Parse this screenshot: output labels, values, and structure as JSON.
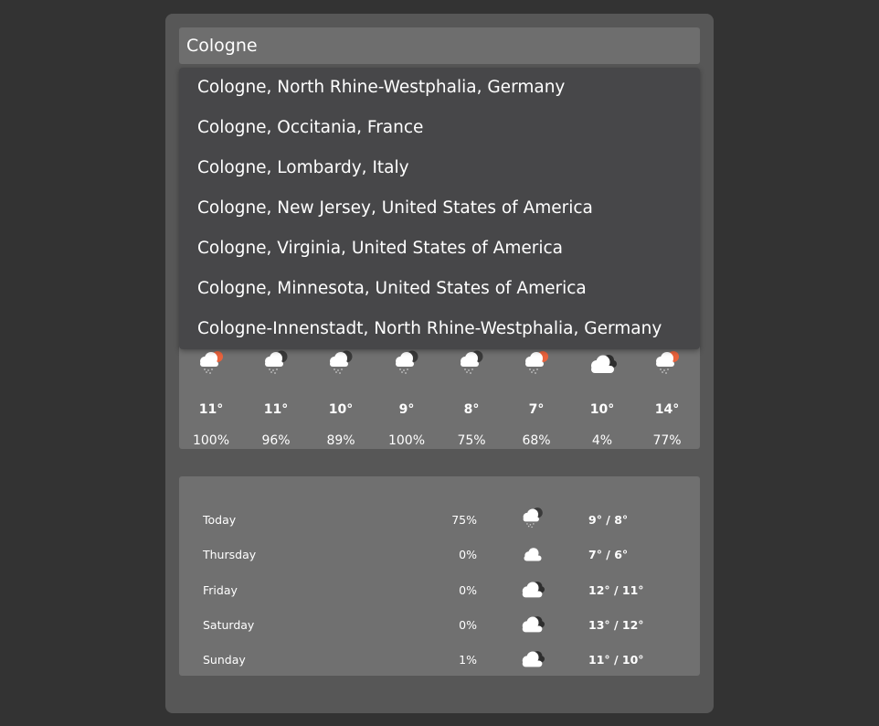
{
  "search": {
    "value": "Cologne"
  },
  "suggestions": [
    "Cologne, North Rhine-Westphalia, Germany",
    "Cologne, Occitania, France",
    "Cologne, Lombardy, Italy",
    "Cologne, New Jersey, United States of America",
    "Cologne, Virginia, United States of America",
    "Cologne, Minnesota, United States of America",
    "Cologne-Innenstadt, North Rhine-Westphalia, Germany"
  ],
  "hourly": [
    {
      "icon": "rain-sun-icon",
      "temp": "11°",
      "precip": "100%"
    },
    {
      "icon": "rain-moon-icon",
      "temp": "11°",
      "precip": "96%"
    },
    {
      "icon": "rain-moon-icon",
      "temp": "10°",
      "precip": "89%"
    },
    {
      "icon": "rain-moon-icon",
      "temp": "9°",
      "precip": "100%"
    },
    {
      "icon": "rain-moon-icon",
      "temp": "8°",
      "precip": "75%"
    },
    {
      "icon": "rain-sun-icon",
      "temp": "7°",
      "precip": "68%"
    },
    {
      "icon": "cloudy-icon",
      "temp": "10°",
      "precip": "4%"
    },
    {
      "icon": "rain-sun-icon",
      "temp": "14°",
      "precip": "77%"
    }
  ],
  "daily": [
    {
      "day": "Today",
      "precip": "75%",
      "icon": "rain-moon-icon",
      "hilo": "9° / 8°"
    },
    {
      "day": "Thursday",
      "precip": "0%",
      "icon": "cloud-icon",
      "hilo": "7° / 6°"
    },
    {
      "day": "Friday",
      "precip": "0%",
      "icon": "cloudy-icon",
      "hilo": "12° / 11°"
    },
    {
      "day": "Saturday",
      "precip": "0%",
      "icon": "cloudy-icon",
      "hilo": "13° / 12°"
    },
    {
      "day": "Sunday",
      "precip": "1%",
      "icon": "cloudy-icon",
      "hilo": "11° / 10°"
    }
  ],
  "colors": {
    "background": "#333333",
    "card": "#575757",
    "panel": "#707070",
    "dropdown": "#474749",
    "sun": "#e8623c"
  }
}
